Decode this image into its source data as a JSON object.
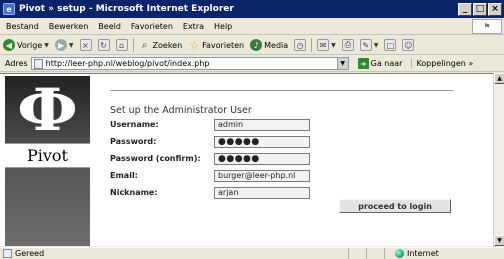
{
  "window": {
    "title": "Pivot » setup - Microsoft Internet Explorer",
    "buttons": [
      "_",
      "□",
      "×"
    ]
  },
  "menu": [
    "Bestand",
    "Bewerken",
    "Beeld",
    "Favorieten",
    "Extra",
    "Help"
  ],
  "toolbar": {
    "back": "Vorige",
    "search": "Zoeken",
    "favorites": "Favorieten",
    "media": "Media"
  },
  "address": {
    "label": "Adres",
    "url": "http://leer-php.nl/weblog/pivot/index.php",
    "go": "Ga naar",
    "links": "Koppelingen"
  },
  "logo": {
    "mark": "Ф",
    "word": "Pivot"
  },
  "form": {
    "heading": "Set up the Administrator User",
    "fields": [
      {
        "label": "Username:",
        "value": "admin"
      },
      {
        "label": "Password:",
        "value": "●●●●●"
      },
      {
        "label": "Password (confirm):",
        "value": "●●●●●"
      },
      {
        "label": "Email:",
        "value": "burger@leer-php.nl"
      },
      {
        "label": "Nickname:",
        "value": "arjan"
      }
    ],
    "submit": "proceed to login"
  },
  "status": {
    "text": "Gereed",
    "zone": "Internet"
  }
}
